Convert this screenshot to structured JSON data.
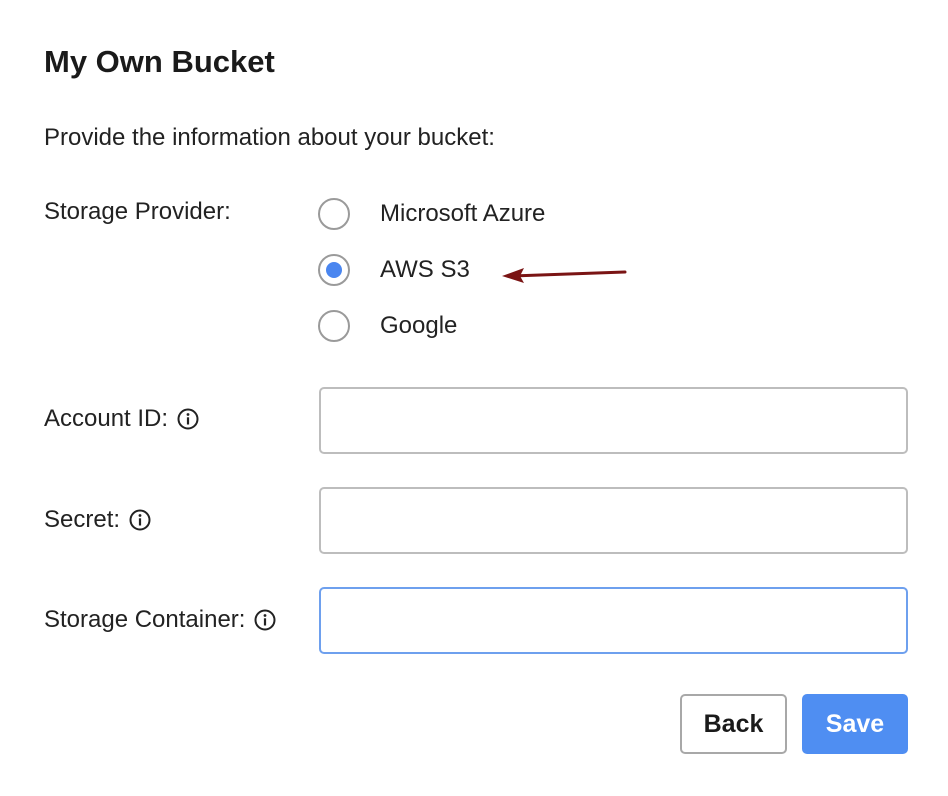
{
  "dialog": {
    "title": "My Own Bucket",
    "intro": "Provide the information about your bucket:"
  },
  "storage_provider": {
    "label": "Storage Provider:",
    "options": [
      {
        "label": "Microsoft Azure",
        "selected": false
      },
      {
        "label": "AWS S3",
        "selected": true
      },
      {
        "label": "Google",
        "selected": false
      }
    ]
  },
  "fields": {
    "account_id": {
      "label": "Account ID:",
      "value": "",
      "placeholder": ""
    },
    "secret": {
      "label": "Secret:",
      "value": "",
      "placeholder": ""
    },
    "storage_container": {
      "label": "Storage Container:",
      "value": "",
      "placeholder": "",
      "focused": true
    }
  },
  "buttons": {
    "back": "Back",
    "save": "Save"
  },
  "colors": {
    "accent": "#4f8ef2",
    "radio_selected": "#4a86f0",
    "annotation_arrow": "#7a1414",
    "input_border": "#bdbdbd",
    "input_focus_border": "#6ea0ee"
  },
  "icons": {
    "info": "info-circle-icon",
    "annotation": "arrow-left-annotation"
  }
}
